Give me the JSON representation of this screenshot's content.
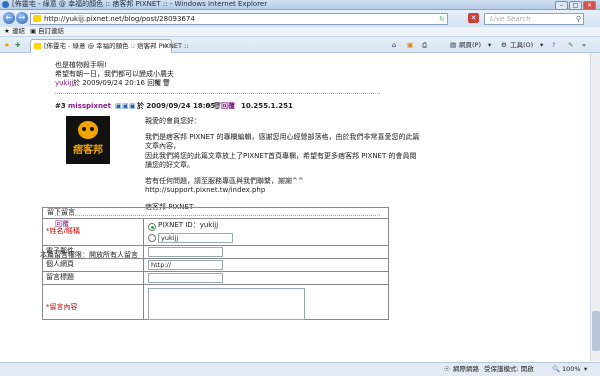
{
  "window": {
    "title": "[佈靈宅 - 綠意 @ 幸福的顏色 :: 痞客邦 PIXNET :: - Windows Internet Explorer",
    "controls": [
      "–",
      "□",
      "✕"
    ]
  },
  "address_bar": {
    "url": "http://yukijj.pixnet.net/blog/post/28093674",
    "search_placeholder": "Live Search"
  },
  "favorites_bar": {
    "favorites": "連結",
    "feeds": "自訂連結"
  },
  "tab": {
    "title": "[佈靈宅 - 綠意 @ 幸福的顏色 :: 痞客邦 PIXNET ::"
  },
  "toolbar": {
    "page": "網頁(P)",
    "tools": "工具(O)"
  },
  "comment2": {
    "line1": "也是植物殺手啊!",
    "line2": "希望有朝一日，我們都可以變成小農夫",
    "author": "yukijj",
    "meta": "於 2009/09/24 20:16 回覆"
  },
  "comment3": {
    "num": "#3",
    "author": "misspixnet",
    "meta": "於 2009/09/24 18:05",
    "reply": "回覆",
    "ip": "10.255.1.251",
    "avatar_text": "痞客邦",
    "body": [
      "親愛的會員您好：",
      "",
      "我們是痞客邦 PIXNET 的專欄編輯，感謝您用心經營部落格，由於我們非常喜愛您的此篇",
      "文章內容，",
      "因此我們將您的此篇文章放上了PIXNET首頁專欄，希望有更多痞客邦 PIXNET 的會員閱",
      "讀您的好文章。",
      "",
      "若有任何問題，請至服務專區與我們聯繫，謝謝^^",
      "http://support.pixnet.tw/index.php",
      "",
      "痞客邦 PIXNET"
    ],
    "reply_link": "回覆"
  },
  "form": {
    "permission": "本篇留言權限：開放所有人留言",
    "header": "留下留言",
    "name_label": "*姓名/暱稱",
    "option_pixnet": "PIXNET ID：yukijj",
    "option_guest": "yukijj",
    "email_label": "電子郵件",
    "homepage_label": "個人網頁",
    "homepage_value": "http://",
    "subject_label": "留言標題",
    "content_label": "*留言內容"
  },
  "status": {
    "zone": "網際網路",
    "protected": "受保護模式: 開啟",
    "zoom": "100%"
  }
}
